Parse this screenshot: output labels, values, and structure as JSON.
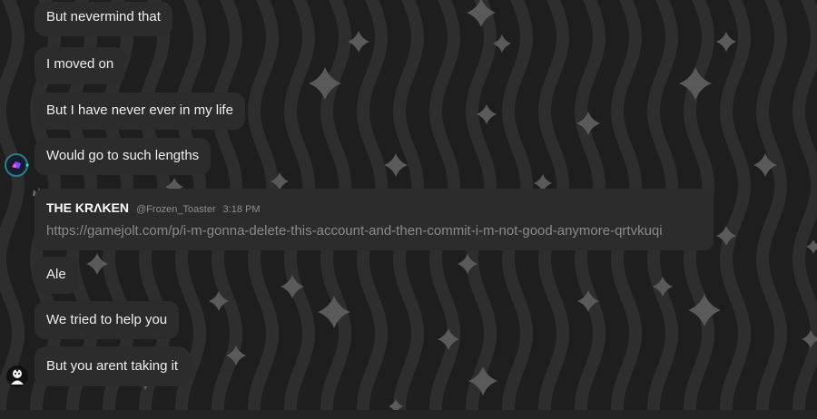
{
  "messages": [
    {
      "text": "But nevermind that"
    },
    {
      "text": "I moved on"
    },
    {
      "text": "But I have never ever in my life"
    },
    {
      "text": "Would go to such lengths"
    },
    {
      "author": "THE KRΛKEN",
      "handle": "@Frozen_Toaster",
      "time": "3:18 PM",
      "link": "https://gamejolt.com/p/i-m-gonna-delete-this-account-and-then-commit-i-m-not-good-anymore-qrtvkuqi"
    },
    {
      "text": "Ale"
    },
    {
      "text": "We tried to help you"
    },
    {
      "text": "But you arent taking it"
    }
  ],
  "icons": {
    "user_avatar_1": "round-avatar-icon",
    "author_badge": "crown-icon",
    "user_avatar_2": "character-avatar-icon"
  },
  "colors": {
    "background": "#1e1e1e",
    "pattern": "#2e2e2e",
    "bubble": "#2c2c2c",
    "text": "#efefef",
    "link": "#8a8a8a",
    "sparkle": "#5a5a5a"
  }
}
